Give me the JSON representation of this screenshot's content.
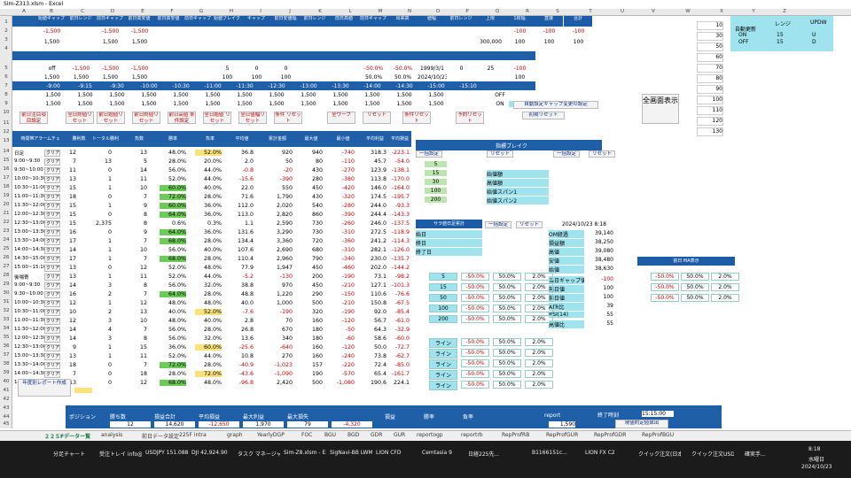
{
  "window": {
    "title": "Sim-Z313.xlsm - Excel"
  },
  "columns": [
    "A",
    "B",
    "C",
    "D",
    "E",
    "F",
    "G",
    "H",
    "I",
    "J",
    "K",
    "L",
    "M",
    "N",
    "O",
    "P",
    "Q",
    "R",
    "S",
    "T",
    "U",
    "V",
    "W",
    "X",
    "Y",
    "Z"
  ],
  "rows": [
    "1",
    "2",
    "3",
    "4",
    "5",
    "6",
    "7",
    "8",
    "9",
    "10",
    "11",
    "12",
    "13",
    "14",
    "15",
    "16",
    "17",
    "18",
    "19",
    "20",
    "21",
    "22",
    "23",
    "24",
    "25",
    "26",
    "27",
    "28",
    "29",
    "30",
    "31",
    "32",
    "33",
    "34",
    "35",
    "36",
    "37",
    "38",
    "39",
    "40",
    "41",
    "42",
    "43",
    "44",
    "45",
    "46",
    "47"
  ],
  "top_headers": [
    "始値ギャップ",
    "前日レンジ",
    "前日ギャップ",
    "前日高安値",
    "前日高安値",
    "前日ギャップ",
    "始値ブレイク",
    "ギャップ",
    "前日安値幅",
    "前日レンジ",
    "前日高値",
    "前日ギャップ",
    "出来高",
    "値幅",
    "前日レンジ",
    "上限",
    "1枚幅",
    "直接",
    "合計"
  ],
  "row1": [
    "-1,500",
    "",
    "-1,500",
    "-1,500",
    "",
    "",
    "",
    "",
    "",
    "",
    "",
    "",
    "",
    "",
    "",
    "",
    "-100",
    "-100",
    "-100"
  ],
  "row2": [
    "1,500",
    "",
    "1,500",
    "1,500",
    "",
    "",
    "",
    "",
    "",
    "",
    "",
    "",
    "",
    "",
    "",
    "300,000",
    "100",
    "100",
    "100"
  ],
  "row5": [
    "off",
    "-1,500",
    "-1,500",
    "-1,500",
    "",
    "",
    "5",
    "0",
    "0",
    "",
    "",
    "-50.0%",
    "-50.0%",
    "1999/3/1",
    "0",
    "25",
    "-100"
  ],
  "row6": [
    "1,500",
    "1,500",
    "1,500",
    "1,500",
    "",
    "",
    "100",
    "100",
    "100",
    "",
    "",
    "50.0%",
    "50.0%",
    "2024/10/23",
    "",
    "",
    "100"
  ],
  "row7_times": [
    "-9:00",
    "-9:15",
    "-9:30",
    "-10:00",
    "-10:30",
    "-11:00",
    "-11:30",
    "-12:30",
    "-13:00",
    "-13:30",
    "-14:00",
    "-14:30",
    "-15:00",
    "-15:10"
  ],
  "row8": [
    "1,500",
    "1,500",
    "1,500",
    "1,500",
    "1,500",
    "1,500",
    "1,500",
    "1,500",
    "1,500",
    "1,500",
    "1,500",
    "1,500",
    "1,500",
    "",
    "OFF"
  ],
  "row9": [
    "1,500",
    "1,500",
    "1,500",
    "1,500",
    "1,500",
    "1,500",
    "1,500",
    "1,500",
    "1,500",
    "1,500",
    "1,500",
    "1,500",
    "1,500",
    "",
    "ON"
  ],
  "r9_right": [
    "15%",
    "100%",
    "全開設定"
  ],
  "buttons_row10": [
    "前日注目項目設定",
    "全日終値リセット",
    "前日始値リセット",
    "前日終値リセット",
    "前日高値 条件設定",
    "全日始値 リセット",
    "全日値幅リセット",
    "条件 リセット",
    "全ワープ",
    "リセット",
    "条件リセット",
    "予約リセット"
  ],
  "btn_auto": "自動設定ギャップ変更の設定",
  "btn_full": "全画面表示",
  "btn_reset": "初期リセット",
  "main_headers": [
    "時間帯",
    "アラームチェック",
    "勝利数",
    "トータル勝利",
    "負数",
    "勝率",
    "負率",
    "平均値",
    "累計金額",
    "最大値",
    "最小値",
    "平均利益",
    "平均損益"
  ],
  "main_rows": [
    {
      "row": "14",
      "label": "日足",
      "c": "クリア",
      "v": [
        "12",
        "0",
        "13",
        "48.0%",
        "52.0%",
        "36.8",
        "920",
        "940",
        "-740",
        "318.3",
        "-223.1"
      ]
    },
    {
      "row": "15",
      "label": "9:00~9:30",
      "c": "クリア",
      "v": [
        "7",
        "13",
        "5",
        "28.0%",
        "20.0%",
        "2.0",
        "50",
        "80",
        "-110",
        "45.7",
        "-54.0"
      ]
    },
    {
      "row": "16",
      "label": "9:30~10:00",
      "c": "クリア",
      "v": [
        "11",
        "0",
        "14",
        "56.0%",
        "44.0%",
        "-0.8",
        "-20",
        "430",
        "-270",
        "123.9",
        "-138.1"
      ]
    },
    {
      "row": "17",
      "label": "10:00~10:30",
      "c": "クリア",
      "v": [
        "13",
        "1",
        "11",
        "52.0%",
        "44.0%",
        "-15.6",
        "-390",
        "280",
        "-380",
        "113.8",
        "-170.0"
      ]
    },
    {
      "row": "18",
      "label": "10:30~11:00",
      "c": "クリア",
      "v": [
        "15",
        "1",
        "10",
        "60.0%",
        "40.0%",
        "22.0",
        "550",
        "450",
        "-420",
        "146.0",
        "-164.0"
      ]
    },
    {
      "row": "19",
      "label": "11:00~11:30",
      "c": "クリア",
      "v": [
        "18",
        "0",
        "7",
        "72.0%",
        "28.0%",
        "71.6",
        "1,790",
        "430",
        "-320",
        "174.5",
        "-195.7"
      ]
    },
    {
      "row": "20",
      "label": "11:30~12:00",
      "c": "クリア",
      "v": [
        "15",
        "1",
        "9",
        "60.0%",
        "36.0%",
        "112.0",
        "2,020",
        "540",
        "-280",
        "244.0",
        "-93.3"
      ]
    },
    {
      "row": "21",
      "label": "12:00~12:30",
      "c": "クリア",
      "v": [
        "15",
        "0",
        "8",
        "64.0%",
        "36.0%",
        "113.0",
        "2,820",
        "860",
        "-390",
        "244.4",
        "-143.3"
      ]
    },
    {
      "row": "22",
      "label": "12:30~13:00",
      "c": "クリア",
      "v": [
        "15",
        "2,375",
        "8",
        "0.6%",
        "0.3%",
        "1.1",
        "2,590",
        "730",
        "-260",
        "246.0",
        "-137.5"
      ]
    },
    {
      "row": "23",
      "label": "13:00~13:30",
      "c": "クリア",
      "v": [
        "16",
        "0",
        "9",
        "64.0%",
        "36.0%",
        "131.6",
        "3,290",
        "730",
        "-310",
        "272.5",
        "-118.9"
      ]
    },
    {
      "row": "24",
      "label": "13:30~14:00",
      "c": "クリア",
      "v": [
        "17",
        "1",
        "7",
        "68.0%",
        "28.0%",
        "134.4",
        "3,360",
        "720",
        "-360",
        "241.2",
        "-114.3"
      ]
    },
    {
      "row": "25",
      "label": "14:00~14:30",
      "c": "クリア",
      "v": [
        "14",
        "1",
        "10",
        "56.0%",
        "40.0%",
        "107.6",
        "2,690",
        "680",
        "-310",
        "282.1",
        "-126.0"
      ]
    },
    {
      "row": "26",
      "label": "14:30~15:00",
      "c": "クリア",
      "v": [
        "17",
        "1",
        "7",
        "68.0%",
        "28.0%",
        "110.4",
        "2,960",
        "790",
        "-340",
        "230.0",
        "-135.7"
      ]
    },
    {
      "row": "27",
      "label": "15:00~15:10",
      "c": "クリア",
      "v": [
        "13",
        "0",
        "12",
        "52.0%",
        "48.0%",
        "77.9",
        "1,947",
        "450",
        "-460",
        "202.0",
        "-144.2"
      ]
    },
    {
      "row": "28",
      "label": "後場寄",
      "c": "クリア",
      "v": [
        "13",
        "1",
        "11",
        "52.0%",
        "44.0%",
        "-5.2",
        "-130",
        "200",
        "-190",
        "73.1",
        "-98.2"
      ]
    },
    {
      "row": "29",
      "label": "9:00~9:30",
      "c": "クリア",
      "v": [
        "14",
        "3",
        "8",
        "56.0%",
        "32.0%",
        "38.8",
        "970",
        "450",
        "-210",
        "127.1",
        "-101.3"
      ]
    },
    {
      "row": "30",
      "label": "9:30~10:00",
      "c": "クリア",
      "v": [
        "16",
        "2",
        "7",
        "64.0%",
        "28.0%",
        "48.8",
        "1,220",
        "290",
        "-150",
        "110.6",
        "-76.6"
      ]
    },
    {
      "row": "31",
      "label": "10:00~10:30",
      "c": "クリア",
      "v": [
        "12",
        "1",
        "12",
        "48.0%",
        "48.0%",
        "40.0",
        "1,000",
        "500",
        "-210",
        "150.8",
        "-67.5"
      ]
    },
    {
      "row": "32",
      "label": "10:30~11:00",
      "c": "クリア",
      "v": [
        "10",
        "2",
        "13",
        "40.0%",
        "52.0%",
        "-7.6",
        "-190",
        "320",
        "-190",
        "92.0",
        "-85.4"
      ]
    },
    {
      "row": "33",
      "label": "11:00~11:30",
      "c": "クリア",
      "v": [
        "12",
        "3",
        "10",
        "48.0%",
        "40.0%",
        "2.8",
        "70",
        "160",
        "-120",
        "56.7",
        "-61.0"
      ]
    },
    {
      "row": "34",
      "label": "11:30~12:00",
      "c": "クリア",
      "v": [
        "14",
        "4",
        "7",
        "56.0%",
        "28.0%",
        "26.8",
        "670",
        "180",
        "-50",
        "64.3",
        "-32.9"
      ]
    },
    {
      "row": "35",
      "label": "12:00~12:30",
      "c": "クリア",
      "v": [
        "14",
        "3",
        "8",
        "56.0%",
        "32.0%",
        "13.6",
        "340",
        "180",
        "-60",
        "58.6",
        "-60.0"
      ]
    },
    {
      "row": "36",
      "label": "12:30~13:00",
      "c": "クリア",
      "v": [
        "9",
        "1",
        "15",
        "36.0%",
        "60.0%",
        "-25.6",
        "-640",
        "160",
        "-120",
        "50.0",
        "-72.7"
      ]
    },
    {
      "row": "37",
      "label": "13:00~13:30",
      "c": "クリア",
      "v": [
        "13",
        "1",
        "11",
        "52.0%",
        "44.0%",
        "10.8",
        "270",
        "160",
        "-240",
        "73.8",
        "-62.7"
      ]
    },
    {
      "row": "38",
      "label": "13:30~14:00",
      "c": "クリア",
      "v": [
        "18",
        "0",
        "7",
        "72.0%",
        "28.0%",
        "-40.9",
        "-1,023",
        "157",
        "-220",
        "72.4",
        "-85.0"
      ]
    },
    {
      "row": "39",
      "label": "14:00~14:30",
      "c": "クリア",
      "v": [
        "7",
        "0",
        "18",
        "28.0%",
        "72.0%",
        "-43.6",
        "-1,090",
        "190",
        "-570",
        "65.4",
        "-161.7"
      ]
    },
    {
      "row": "40",
      "label": "14:30~15:00",
      "c": "クリア",
      "v": [
        "13",
        "0",
        "12",
        "68.0%",
        "48.0%",
        "-96.8",
        "2,420",
        "500",
        "-1,080",
        "190.6",
        "224.1"
      ]
    }
  ],
  "breakout": {
    "title": "指標ブレイク",
    "reset": "リセット",
    "set": "一括設定",
    "items": [
      "5",
      "15",
      "30",
      "100",
      "200"
    ],
    "labels": [
      "始値額",
      "高値額",
      "始値スパン1",
      "始値スパン2"
    ]
  },
  "mid_panel": {
    "title": "サラ値日足累計",
    "reset": "リセット",
    "set": "一括設定",
    "rows": [
      "始日",
      "終日",
      "終了日"
    ]
  },
  "stats_panel": {
    "date": "2024/10/23 8:18",
    "items": [
      [
        "OM経過",
        "39,140"
      ],
      [
        "損益額",
        "38,250"
      ],
      [
        "高値",
        "39,080"
      ],
      [
        "安値",
        "38,480"
      ],
      [
        "始値",
        "38,630"
      ]
    ]
  },
  "gap_panel": {
    "rows": [
      [
        "当日ギャップ値",
        "-100"
      ],
      [
        "前日値",
        "100"
      ],
      [
        "前日値",
        "100"
      ],
      [
        "ATR比",
        "39"
      ],
      [
        "RSI(14)",
        "55"
      ],
      [
        "高値比",
        "55"
      ]
    ]
  },
  "pct_table1": {
    "rows": [
      [
        "5",
        "-50.0%",
        "50.0%",
        "2.0%"
      ],
      [
        "15",
        "-50.0%",
        "50.0%",
        "2.0%"
      ],
      [
        "50",
        "-50.0%",
        "50.0%",
        "2.0%"
      ],
      [
        "100",
        "-50.0%",
        "50.0%",
        "2.0%"
      ],
      [
        "200",
        "-50.0%",
        "50.0%",
        "2.0%"
      ]
    ]
  },
  "pct_table2": {
    "rows": [
      [
        "ライン",
        "-50.0%",
        "50.0%",
        "2.0%"
      ],
      [
        "ライン",
        "-50.0%",
        "50.0%",
        "2.0%"
      ],
      [
        "ライン",
        "-50.0%",
        "50.0%",
        "2.0%"
      ],
      [
        "ライン",
        "-50.0%",
        "50.0%",
        "2.0%"
      ],
      [
        "ライン",
        "-50.0%",
        "50.0%",
        "2.0%"
      ]
    ]
  },
  "right_ma": {
    "title": "前日 MA表示",
    "rows": [
      [
        "-50.0%",
        "50.0%",
        "2.0%"
      ],
      [
        "-50.0%",
        "50.0%",
        "2.0%"
      ],
      [
        "-50.0%",
        "50.0%",
        "2.0%"
      ]
    ]
  },
  "far_right": {
    "headers": [
      "レンジ",
      "UPDW"
    ],
    "labels": [
      "自動更新",
      "ON",
      "OFF"
    ],
    "vals": [
      [
        "15",
        "U"
      ],
      [
        "15",
        "D"
      ]
    ],
    "colW": [
      "10",
      "30",
      "50",
      "60",
      "70",
      "80",
      "90",
      "100",
      "110",
      "120",
      "130"
    ]
  },
  "bottom": {
    "btn_report": "年度別レポート作成",
    "position": "ポジション",
    "headers1": [
      "勝ち数",
      "損益合計",
      "平均損益",
      "最大利益",
      "最大損失"
    ],
    "vals1": [
      "12",
      "14,620",
      "-12,650",
      "1,970",
      "79",
      "-4,320"
    ],
    "headers2": [
      "損益",
      "勝率",
      "負率"
    ],
    "report": "report",
    "end_time": "終了時刻",
    "end_val": "15:15:00",
    "val1": "1,590",
    "btn_bottom": "現値約定値算出"
  },
  "tabs": [
    "２２５Fデーター覧",
    "analysis",
    "前日データ設定",
    "225F intra",
    "graph",
    "YearlyDGP",
    "FOC",
    "BGU",
    "BGD",
    "GDR",
    "GUR",
    "reportogp",
    "reportrb",
    "RepProfRB",
    "RepProfGUR",
    "RepProfGDR",
    "RepProfBGU"
  ],
  "taskbar": {
    "items": [
      "分足チャート",
      "受注トレイ info@...",
      "USDJPY 151.088 0...",
      "DJI 42,924.90",
      "タスク マネージャー",
      "Sim-Z8.xlsm - Ex...",
      "SigNavi-BB LWM...",
      "LION CFD",
      "Cemtasia 9",
      "日経225先...",
      "B1166151c...",
      "LION FX C2",
      "クイック注文(日本...",
      "クイック注文USD/...",
      "確実手..."
    ],
    "time": "8:18",
    "date": "2024/10/23",
    "weekday": "水曜日"
  }
}
